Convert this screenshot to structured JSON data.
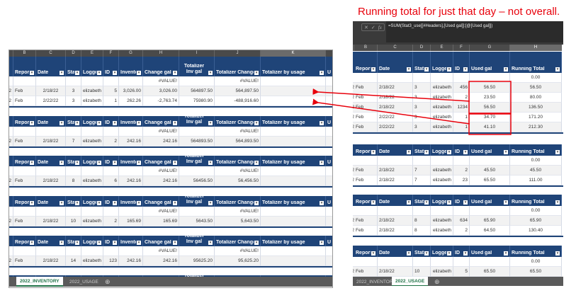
{
  "annotation": {
    "text": "Running total for just that day – not overall.",
    "color": "#e8000b"
  },
  "colors": {
    "header": "#1f4478",
    "highlight": "#e8000b"
  },
  "formula_bar": {
    "cancel_icon": "✕",
    "confirm_icon": "✓",
    "fx_label": "fx",
    "formula": "=SUM(Stat3_use[[#Headers],[Used gal]]:[@[Used gal]])"
  },
  "inventory_sheet": {
    "column_letters": [
      "",
      "B",
      "C",
      "D",
      "E",
      "F",
      "G",
      "H",
      "I",
      "J",
      "K",
      ""
    ],
    "headers": [
      "",
      "Report",
      "Date",
      "Stat",
      "Logged",
      "ID",
      "Invento",
      "Change gal",
      "Totalizer Inv gal",
      "Totalizer Change",
      "Totalizer by usage",
      "U"
    ],
    "tables": [
      {
        "rows": [
          [
            "",
            "",
            "",
            "",
            "",
            "",
            "",
            "#VALUE!",
            "",
            "#VALUE!",
            "",
            ""
          ],
          [
            "2",
            "Feb",
            "2/18/22",
            "3",
            "elizabeth",
            "5",
            "3,026.00",
            "3,026.00",
            "564897.50",
            "564,897.50",
            "",
            ""
          ],
          [
            "2",
            "Feb",
            "2/22/22",
            "3",
            "elizabeth",
            "1",
            "262.26",
            "-2,763.74",
            "75980.90",
            "-488,916.60",
            "",
            ""
          ]
        ]
      },
      {
        "rows": [
          [
            "",
            "",
            "",
            "",
            "",
            "",
            "",
            "#VALUE!",
            "",
            "#VALUE!",
            "",
            ""
          ],
          [
            "2",
            "Feb",
            "2/18/22",
            "7",
            "elizabeth",
            "2",
            "242.16",
            "242.16",
            "564893.50",
            "564,893.50",
            "",
            ""
          ]
        ]
      },
      {
        "rows": [
          [
            "",
            "",
            "",
            "",
            "",
            "",
            "",
            "#VALUE!",
            "",
            "#VALUE!",
            "",
            ""
          ],
          [
            "2",
            "Feb",
            "2/18/22",
            "8",
            "elizabeth",
            "6",
            "242.16",
            "242.16",
            "56456.50",
            "56,456.50",
            "",
            ""
          ]
        ]
      },
      {
        "rows": [
          [
            "",
            "",
            "",
            "",
            "",
            "",
            "",
            "#VALUE!",
            "",
            "#VALUE!",
            "",
            ""
          ],
          [
            "2",
            "Feb",
            "2/18/22",
            "10",
            "elizabeth",
            "2",
            "165.69",
            "165.69",
            "5643.50",
            "5,643.50",
            "",
            ""
          ]
        ]
      },
      {
        "rows": [
          [
            "",
            "",
            "",
            "",
            "",
            "",
            "",
            "#VALUE!",
            "",
            "#VALUE!",
            "",
            ""
          ],
          [
            "2",
            "Feb",
            "2/18/22",
            "14",
            "elizabeth",
            "123",
            "242.16",
            "242.16",
            "95625.20",
            "95,625.20",
            "",
            ""
          ]
        ]
      },
      {
        "rows": []
      }
    ],
    "tabs": [
      {
        "label": "2022_INVENTORY",
        "active": true
      },
      {
        "label": "2022_USAGE",
        "active": false
      }
    ],
    "add_sheet_icon": "⊕"
  },
  "usage_sheet": {
    "column_letters": [
      "",
      "B",
      "C",
      "D",
      "E",
      "F",
      "G",
      "H"
    ],
    "headers": [
      "",
      "Report",
      "Date",
      "Stati",
      "Logged",
      "ID",
      "Used gal",
      "Running Total"
    ],
    "tables": [
      {
        "rows": [
          [
            "",
            "",
            "",
            "",
            "",
            "",
            "",
            "0.00"
          ],
          [
            "2",
            "Feb",
            "2/18/22",
            "3",
            "elizabeth",
            "456",
            "56.50",
            "56.50"
          ],
          [
            "2",
            "Feb",
            "2/18/22",
            "3",
            "elizabeth",
            "2",
            "23.50",
            "80.00"
          ],
          [
            "2",
            "Feb",
            "2/18/22",
            "3",
            "elizabeth",
            "1234",
            "56.50",
            "136.50"
          ],
          [
            "2",
            "Feb",
            "2/22/22",
            "3",
            "elizabeth",
            "1",
            "34.70",
            "171.20"
          ],
          [
            "2",
            "Feb",
            "2/22/22",
            "3",
            "elizabeth",
            "1",
            "41.10",
            "212.30"
          ]
        ]
      },
      {
        "rows": [
          [
            "",
            "",
            "",
            "",
            "",
            "",
            "",
            "0.00"
          ],
          [
            "2",
            "Feb",
            "2/18/22",
            "7",
            "elizabeth",
            "2",
            "45.50",
            "45.50"
          ],
          [
            "2",
            "Feb",
            "2/18/22",
            "7",
            "elizabeth",
            "23",
            "65.50",
            "111.00"
          ]
        ]
      },
      {
        "rows": [
          [
            "",
            "",
            "",
            "",
            "",
            "",
            "",
            "0.00"
          ],
          [
            "2",
            "Feb",
            "2/18/22",
            "8",
            "elizabeth",
            "634",
            "65.90",
            "65.90"
          ],
          [
            "2",
            "Feb",
            "2/18/22",
            "8",
            "elizabeth",
            "2",
            "64.50",
            "130.40"
          ]
        ]
      },
      {
        "rows": [
          [
            "",
            "",
            "",
            "",
            "",
            "",
            "",
            "0.00"
          ],
          [
            "2",
            "Feb",
            "2/18/22",
            "10",
            "elizabeth",
            "5",
            "65.50",
            "65.50"
          ]
        ]
      }
    ],
    "tabs": [
      {
        "label": "2022_INVENTORY",
        "active": false
      },
      {
        "label": "2022_USAGE",
        "active": true
      }
    ],
    "add_sheet_icon": "⊕"
  }
}
